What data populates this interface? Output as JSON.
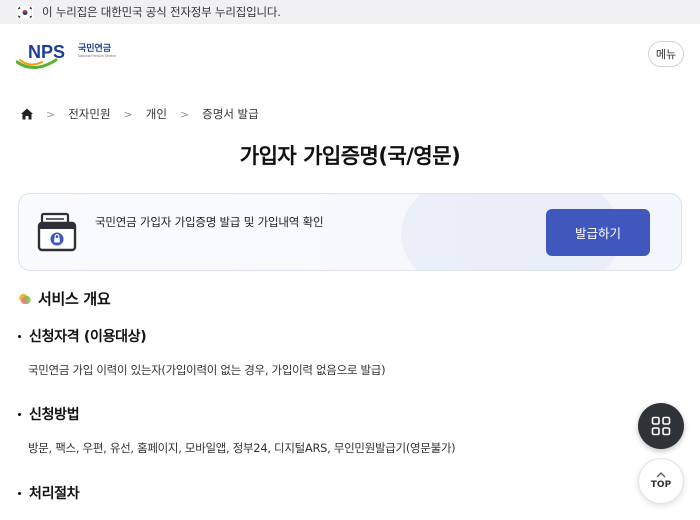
{
  "gov_bar": {
    "text": "이 누리집은 대한민국 공식 전자정부 누리집입니다."
  },
  "header": {
    "logo_text": "NPS",
    "logo_korean": "국민연금",
    "logo_sub": "National Pension Service",
    "menu_label": "메뉴"
  },
  "breadcrumb": {
    "items": [
      "전자민원",
      "개인",
      "증명서 발급"
    ]
  },
  "page_title": "가입자 가입증명(국/영문)",
  "service_card": {
    "description": "국민연금 가입자 가입증명 발급 및 가입내역 확인",
    "button_label": "발급하기"
  },
  "overview": {
    "title": "서비스 개요",
    "sections": [
      {
        "heading": "신청자격 (이용대상)",
        "body": "국민연금 가입 이력이 있는자(가입이력이 없는 경우, 가입이력 없음으로 발급)"
      },
      {
        "heading": "신청방법",
        "body": "방문, 팩스, 우편, 유선, 홈페이지, 모바일앱, 정부24, 디지털ARS, 무인민원발급기(영문불가)"
      },
      {
        "heading": "처리절차",
        "body": ""
      }
    ]
  },
  "floating": {
    "top_label": "TOP"
  },
  "colors": {
    "primary_button": "#4058bd",
    "logo_blue": "#1c3f94",
    "logo_green": "#5ab031",
    "logo_orange": "#f39c12",
    "fab_dark": "#2f3237"
  }
}
